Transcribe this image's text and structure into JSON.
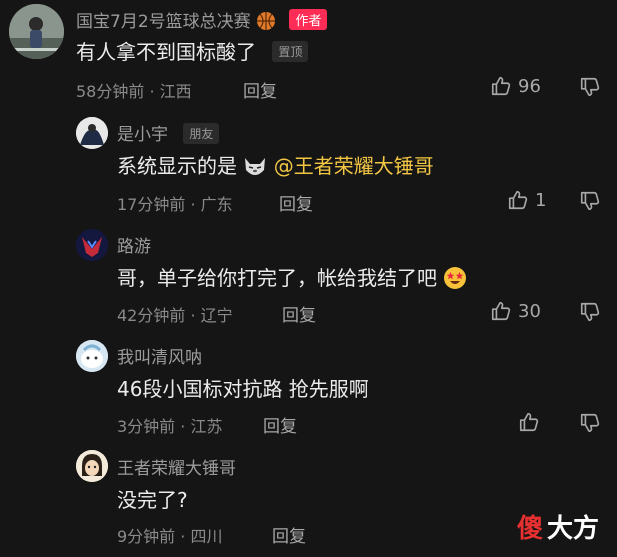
{
  "comments": [
    {
      "username": "国宝7月2号篮球总决赛",
      "author_badge": "作者",
      "text": "有人拿不到国标酸了",
      "pin_badge": "置顶",
      "meta": "58分钟前 · 江西",
      "reply_label": "回复",
      "likes": "96"
    },
    {
      "username": "是小宇",
      "friend_badge": "朋友",
      "text_prefix": "系统显示的是",
      "mention": "@王者荣耀大锤哥",
      "meta": "17分钟前 · 广东",
      "reply_label": "回复",
      "likes": "1"
    },
    {
      "username": "路游",
      "text": "哥，单子给你打完了，帐给我结了吧",
      "meta": "42分钟前 · 辽宁",
      "reply_label": "回复",
      "likes": "30"
    },
    {
      "username": "我叫清风呐",
      "text": "46段小国标对抗路 抢先服啊",
      "meta": "3分钟前 · 江苏",
      "reply_label": "回复",
      "likes": ""
    },
    {
      "username": "王者荣耀大锤哥",
      "text": "没完了?",
      "meta": "9分钟前 · 四川",
      "reply_label": "回复",
      "likes": ""
    }
  ],
  "watermark": {
    "char1": "傻",
    "rest": "大方"
  },
  "colors": {
    "background": "#151515",
    "author_badge": "#ff2c55",
    "mention": "#f3c744"
  },
  "icons": [
    "thumbs-up-icon",
    "thumbs-down-icon",
    "basketball-icon",
    "cat-face-icon",
    "star-struck-emoji-icon"
  ]
}
